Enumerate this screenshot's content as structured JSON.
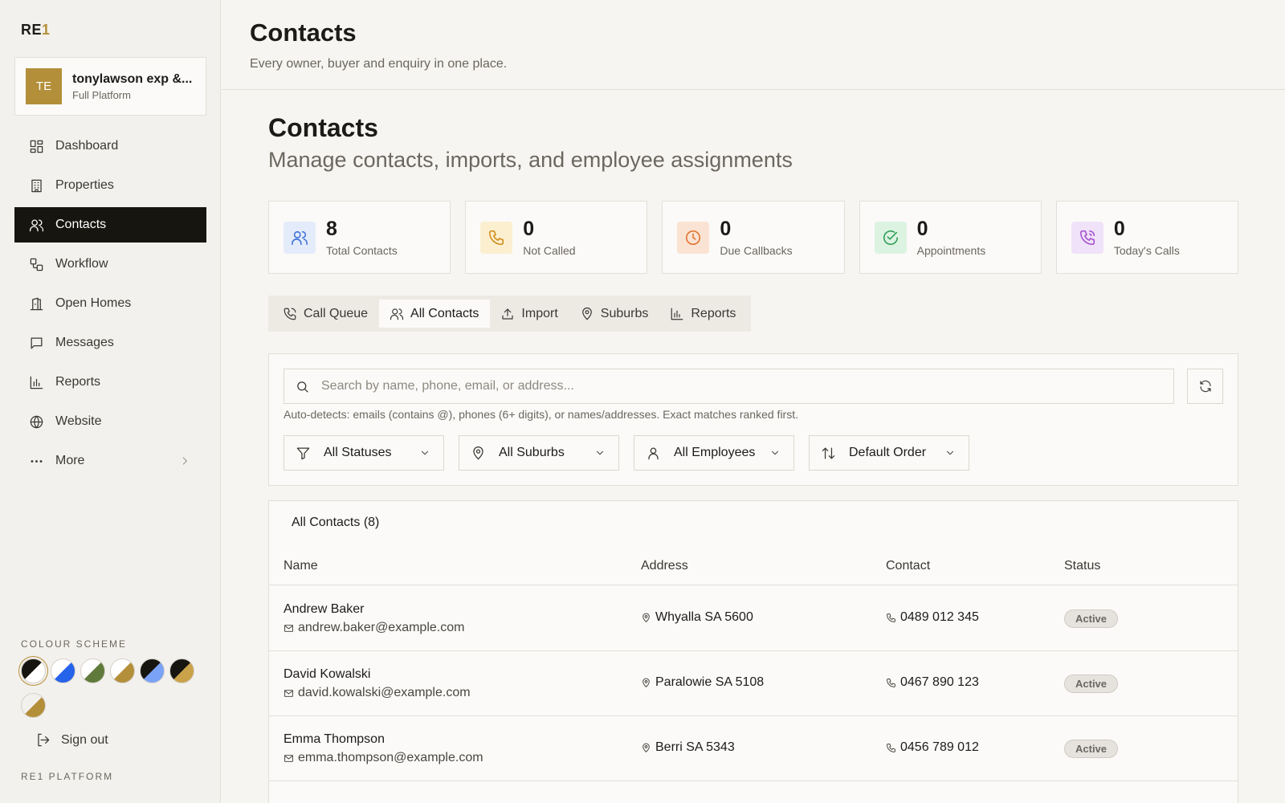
{
  "brand": {
    "logo_main": "RE",
    "logo_accent": "1",
    "platform_label": "RE1 PLATFORM"
  },
  "account": {
    "initials": "TE",
    "name": "tonylawson exp &...",
    "plan": "Full Platform"
  },
  "nav": {
    "items": [
      {
        "label": "Dashboard",
        "icon": "dashboard-icon"
      },
      {
        "label": "Properties",
        "icon": "building-icon"
      },
      {
        "label": "Contacts",
        "icon": "users-icon",
        "active": true
      },
      {
        "label": "Workflow",
        "icon": "workflow-icon"
      },
      {
        "label": "Open Homes",
        "icon": "open-home-icon"
      },
      {
        "label": "Messages",
        "icon": "message-icon"
      },
      {
        "label": "Reports",
        "icon": "bar-chart-icon"
      },
      {
        "label": "Website",
        "icon": "globe-icon"
      },
      {
        "label": "More",
        "icon": "more-icon"
      }
    ]
  },
  "colour_scheme": {
    "label": "COLOUR SCHEME",
    "swatches": [
      {
        "a": "#16150f",
        "b": "#ffffff",
        "selected": true
      },
      {
        "a": "#ffffff",
        "b": "#2563eb"
      },
      {
        "a": "#ffffff",
        "b": "#5f7a3a"
      },
      {
        "a": "#ffffff",
        "b": "#b48f3a"
      },
      {
        "a": "#16150f",
        "b": "#7aa2f7"
      },
      {
        "a": "#16150f",
        "b": "#c9a24a"
      },
      {
        "a": "#f3f1ed",
        "b": "#b48f3a"
      }
    ]
  },
  "signout_label": "Sign out",
  "header": {
    "title": "Contacts",
    "subtitle": "Every owner, buyer and enquiry in one place."
  },
  "page": {
    "title": "Contacts",
    "subtitle": "Manage contacts, imports, and employee assignments"
  },
  "stats": [
    {
      "value": "8",
      "label": "Total Contacts",
      "icon": "users-icon",
      "bg": "#e4ecfb",
      "stroke": "#3b6fd8"
    },
    {
      "value": "0",
      "label": "Not Called",
      "icon": "phone-icon",
      "bg": "#fbefd0",
      "stroke": "#d08a14"
    },
    {
      "value": "0",
      "label": "Due Callbacks",
      "icon": "clock-icon",
      "bg": "#fbe3d3",
      "stroke": "#e0722b"
    },
    {
      "value": "0",
      "label": "Appointments",
      "icon": "check-circle-icon",
      "bg": "#dcf3e2",
      "stroke": "#2f9e55"
    },
    {
      "value": "0",
      "label": "Today's Calls",
      "icon": "phone-call-icon",
      "bg": "#f0e2f8",
      "stroke": "#a54fd1"
    }
  ],
  "tabs": [
    {
      "label": "Call Queue",
      "icon": "phone-icon"
    },
    {
      "label": "All Contacts",
      "icon": "users-icon",
      "active": true
    },
    {
      "label": "Import",
      "icon": "upload-icon"
    },
    {
      "label": "Suburbs",
      "icon": "map-pin-icon"
    },
    {
      "label": "Reports",
      "icon": "bar-chart-icon"
    }
  ],
  "search": {
    "placeholder": "Search by name, phone, email, or address...",
    "value": "",
    "hint": "Auto-detects: emails (contains @), phones (6+ digits), or names/addresses. Exact matches ranked first."
  },
  "filters": [
    {
      "label": "All Statuses",
      "icon": "filter-icon"
    },
    {
      "label": "All Suburbs",
      "icon": "map-pin-icon"
    },
    {
      "label": "All Employees",
      "icon": "user-icon"
    },
    {
      "label": "Default Order",
      "icon": "sort-icon"
    }
  ],
  "table": {
    "title": "All Contacts (8)",
    "columns": [
      "Name",
      "Address",
      "Contact",
      "Status"
    ],
    "rows": [
      {
        "name": "Andrew Baker",
        "email": "andrew.baker@example.com",
        "address": "Whyalla SA 5600",
        "phone": "0489 012 345",
        "status": "Active"
      },
      {
        "name": "David Kowalski",
        "email": "david.kowalski@example.com",
        "address": "Paralowie SA 5108",
        "phone": "0467 890 123",
        "status": "Active"
      },
      {
        "name": "Emma Thompson",
        "email": "emma.thompson@example.com",
        "address": "Berri SA 5343",
        "phone": "0456 789 012",
        "status": "Active"
      }
    ]
  }
}
